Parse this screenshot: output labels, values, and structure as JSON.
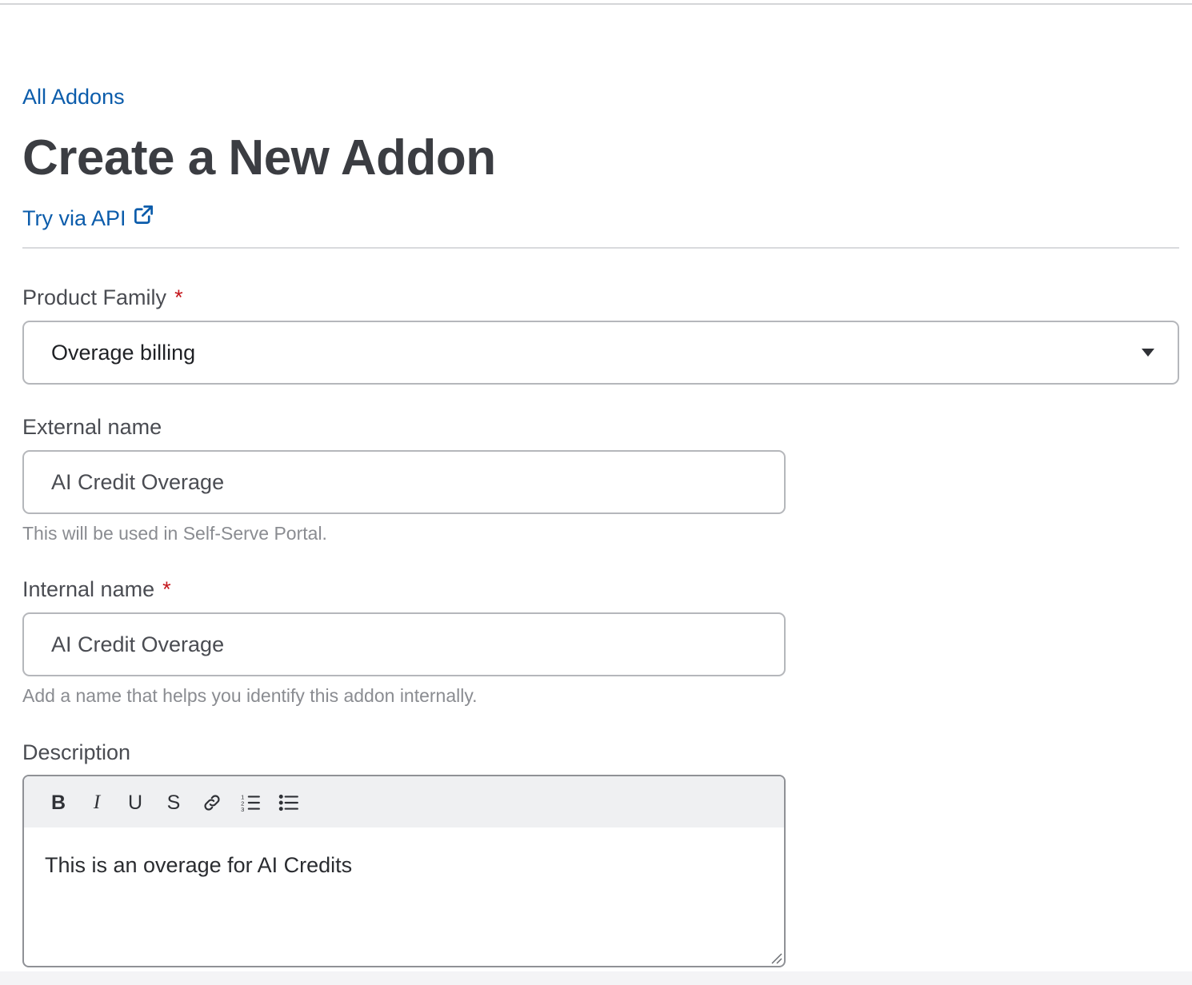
{
  "breadcrumb": {
    "label": "All Addons"
  },
  "page": {
    "title": "Create a New Addon",
    "api_link_label": "Try via API"
  },
  "form": {
    "product_family": {
      "label": "Product Family",
      "required_marker": "*",
      "selected": "Overage billing"
    },
    "external_name": {
      "label": "External name",
      "value": "AI Credit Overage",
      "help": "This will be used in Self-Serve Portal."
    },
    "internal_name": {
      "label": "Internal name",
      "required_marker": "*",
      "value": "AI Credit Overage",
      "help": "Add a name that helps you identify this addon internally."
    },
    "description": {
      "label": "Description",
      "toolbar": {
        "bold": "B",
        "italic": "I",
        "underline": "U",
        "strike": "S",
        "link_icon": "link-icon",
        "ordered_list_icon": "ordered-list-icon",
        "bullet_list_icon": "bullet-list-icon"
      },
      "value": "This is an overage for AI Credits"
    }
  },
  "colors": {
    "link": "#0b5cab",
    "required": "#c4161c",
    "title": "#3b3d42",
    "toolbar_bg": "#eff0f2"
  }
}
